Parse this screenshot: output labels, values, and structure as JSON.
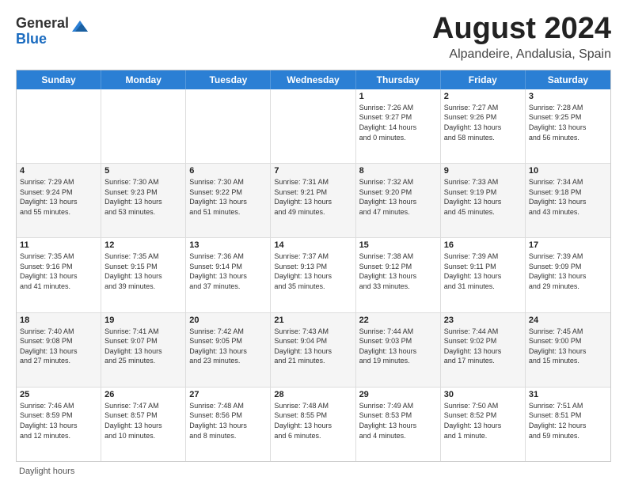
{
  "logo": {
    "general": "General",
    "blue": "Blue"
  },
  "title": "August 2024",
  "subtitle": "Alpandeire, Andalusia, Spain",
  "footer": "Daylight hours",
  "days_of_week": [
    "Sunday",
    "Monday",
    "Tuesday",
    "Wednesday",
    "Thursday",
    "Friday",
    "Saturday"
  ],
  "weeks": [
    [
      {
        "day": "",
        "info": ""
      },
      {
        "day": "",
        "info": ""
      },
      {
        "day": "",
        "info": ""
      },
      {
        "day": "",
        "info": ""
      },
      {
        "day": "1",
        "info": "Sunrise: 7:26 AM\nSunset: 9:27 PM\nDaylight: 14 hours\nand 0 minutes."
      },
      {
        "day": "2",
        "info": "Sunrise: 7:27 AM\nSunset: 9:26 PM\nDaylight: 13 hours\nand 58 minutes."
      },
      {
        "day": "3",
        "info": "Sunrise: 7:28 AM\nSunset: 9:25 PM\nDaylight: 13 hours\nand 56 minutes."
      }
    ],
    [
      {
        "day": "4",
        "info": "Sunrise: 7:29 AM\nSunset: 9:24 PM\nDaylight: 13 hours\nand 55 minutes."
      },
      {
        "day": "5",
        "info": "Sunrise: 7:30 AM\nSunset: 9:23 PM\nDaylight: 13 hours\nand 53 minutes."
      },
      {
        "day": "6",
        "info": "Sunrise: 7:30 AM\nSunset: 9:22 PM\nDaylight: 13 hours\nand 51 minutes."
      },
      {
        "day": "7",
        "info": "Sunrise: 7:31 AM\nSunset: 9:21 PM\nDaylight: 13 hours\nand 49 minutes."
      },
      {
        "day": "8",
        "info": "Sunrise: 7:32 AM\nSunset: 9:20 PM\nDaylight: 13 hours\nand 47 minutes."
      },
      {
        "day": "9",
        "info": "Sunrise: 7:33 AM\nSunset: 9:19 PM\nDaylight: 13 hours\nand 45 minutes."
      },
      {
        "day": "10",
        "info": "Sunrise: 7:34 AM\nSunset: 9:18 PM\nDaylight: 13 hours\nand 43 minutes."
      }
    ],
    [
      {
        "day": "11",
        "info": "Sunrise: 7:35 AM\nSunset: 9:16 PM\nDaylight: 13 hours\nand 41 minutes."
      },
      {
        "day": "12",
        "info": "Sunrise: 7:35 AM\nSunset: 9:15 PM\nDaylight: 13 hours\nand 39 minutes."
      },
      {
        "day": "13",
        "info": "Sunrise: 7:36 AM\nSunset: 9:14 PM\nDaylight: 13 hours\nand 37 minutes."
      },
      {
        "day": "14",
        "info": "Sunrise: 7:37 AM\nSunset: 9:13 PM\nDaylight: 13 hours\nand 35 minutes."
      },
      {
        "day": "15",
        "info": "Sunrise: 7:38 AM\nSunset: 9:12 PM\nDaylight: 13 hours\nand 33 minutes."
      },
      {
        "day": "16",
        "info": "Sunrise: 7:39 AM\nSunset: 9:11 PM\nDaylight: 13 hours\nand 31 minutes."
      },
      {
        "day": "17",
        "info": "Sunrise: 7:39 AM\nSunset: 9:09 PM\nDaylight: 13 hours\nand 29 minutes."
      }
    ],
    [
      {
        "day": "18",
        "info": "Sunrise: 7:40 AM\nSunset: 9:08 PM\nDaylight: 13 hours\nand 27 minutes."
      },
      {
        "day": "19",
        "info": "Sunrise: 7:41 AM\nSunset: 9:07 PM\nDaylight: 13 hours\nand 25 minutes."
      },
      {
        "day": "20",
        "info": "Sunrise: 7:42 AM\nSunset: 9:05 PM\nDaylight: 13 hours\nand 23 minutes."
      },
      {
        "day": "21",
        "info": "Sunrise: 7:43 AM\nSunset: 9:04 PM\nDaylight: 13 hours\nand 21 minutes."
      },
      {
        "day": "22",
        "info": "Sunrise: 7:44 AM\nSunset: 9:03 PM\nDaylight: 13 hours\nand 19 minutes."
      },
      {
        "day": "23",
        "info": "Sunrise: 7:44 AM\nSunset: 9:02 PM\nDaylight: 13 hours\nand 17 minutes."
      },
      {
        "day": "24",
        "info": "Sunrise: 7:45 AM\nSunset: 9:00 PM\nDaylight: 13 hours\nand 15 minutes."
      }
    ],
    [
      {
        "day": "25",
        "info": "Sunrise: 7:46 AM\nSunset: 8:59 PM\nDaylight: 13 hours\nand 12 minutes."
      },
      {
        "day": "26",
        "info": "Sunrise: 7:47 AM\nSunset: 8:57 PM\nDaylight: 13 hours\nand 10 minutes."
      },
      {
        "day": "27",
        "info": "Sunrise: 7:48 AM\nSunset: 8:56 PM\nDaylight: 13 hours\nand 8 minutes."
      },
      {
        "day": "28",
        "info": "Sunrise: 7:48 AM\nSunset: 8:55 PM\nDaylight: 13 hours\nand 6 minutes."
      },
      {
        "day": "29",
        "info": "Sunrise: 7:49 AM\nSunset: 8:53 PM\nDaylight: 13 hours\nand 4 minutes."
      },
      {
        "day": "30",
        "info": "Sunrise: 7:50 AM\nSunset: 8:52 PM\nDaylight: 13 hours\nand 1 minute."
      },
      {
        "day": "31",
        "info": "Sunrise: 7:51 AM\nSunset: 8:51 PM\nDaylight: 12 hours\nand 59 minutes."
      }
    ]
  ]
}
